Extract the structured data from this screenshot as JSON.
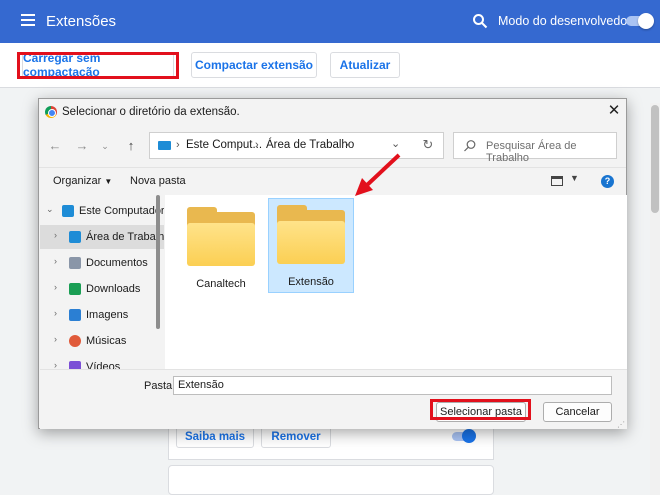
{
  "header": {
    "title": "Extensões",
    "dev_mode_label": "Modo do desenvolvedor"
  },
  "toolbar": {
    "load_unpacked": "Carregar sem compactação",
    "pack_extension": "Compactar extensão",
    "update": "Atualizar"
  },
  "card": {
    "details_button": "Saiba mais",
    "remove_button": "Remover"
  },
  "dialog": {
    "title": "Selecionar o diretório da extensão.",
    "breadcrumb": [
      "Este Comput...",
      "Área de Trabalho"
    ],
    "search_placeholder": "Pesquisar Área de Trabalho",
    "organize": "Organizar",
    "new_folder": "Nova pasta",
    "nav_items": [
      {
        "label": "Este Computador",
        "icon": "computer-icon"
      },
      {
        "label": "Área de Trabalho",
        "icon": "desktop-icon"
      },
      {
        "label": "Documentos",
        "icon": "document-icon"
      },
      {
        "label": "Downloads",
        "icon": "download-icon"
      },
      {
        "label": "Imagens",
        "icon": "image-icon"
      },
      {
        "label": "Músicas",
        "icon": "music-icon"
      },
      {
        "label": "Vídeos",
        "icon": "video-icon"
      }
    ],
    "folders": [
      {
        "name": "Canaltech",
        "selected": false
      },
      {
        "name": "Extensão",
        "selected": true
      }
    ],
    "folder_label": "Pasta:",
    "folder_value": "Extensão",
    "select_button": "Selecionar pasta",
    "cancel_button": "Cancelar"
  },
  "colors": {
    "header_bg": "#3569d0",
    "accent": "#1a73e8",
    "highlight_red": "#e2101c",
    "selection": "#cce8ff"
  }
}
